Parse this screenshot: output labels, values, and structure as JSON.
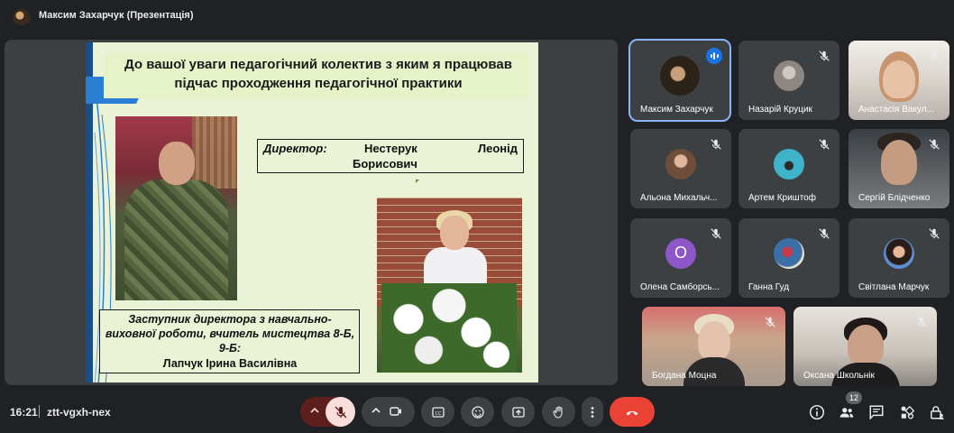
{
  "window": {
    "title": "Максим Захарчук (Презентація)"
  },
  "slide": {
    "title": "До вашої уваги педагогічний колектив з яким я працював підчас проходження педагогічної практики",
    "director_role": "Директор:",
    "director_name_word1": "Нестерук",
    "director_name_word2": "Леонід",
    "director_name_line2": "Борисович",
    "deputy_role": "Заступник директора з навчально-виховної роботи, вчитель мистецтва 8-Б, 9-Б:",
    "deputy_name": "Лапчук Ірина Василівна"
  },
  "participants": [
    {
      "name": "Максим Захарчук"
    },
    {
      "name": "Назарій Круцик"
    },
    {
      "name": "Анастасія Вакул..."
    },
    {
      "name": "Альона Михальч..."
    },
    {
      "name": "Артем Криштоф"
    },
    {
      "name": "Сергій Блідченко"
    },
    {
      "name": "Олена Самборсь...",
      "initial": "О"
    },
    {
      "name": "Ганна Гуд"
    },
    {
      "name": "Світлана Марчук"
    },
    {
      "name": "Богдана Моцна"
    },
    {
      "name": "Оксана Школьнік"
    }
  ],
  "bottom_bar": {
    "time": "16:21",
    "meeting_code": "ztt-vgxh-nex",
    "people_count": "12"
  },
  "colors": {
    "background": "#202124",
    "tile": "#3c4043",
    "accent": "#8ab4f8",
    "end_call": "#ea4335",
    "mic_off": "#f9dedc"
  }
}
